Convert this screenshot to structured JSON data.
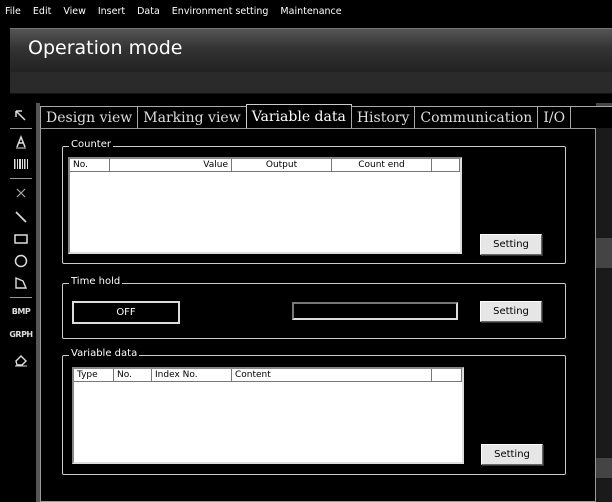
{
  "menu": [
    "File",
    "Edit",
    "View",
    "Insert",
    "Data",
    "Environment setting",
    "Maintenance"
  ],
  "title": "Operation mode",
  "toolbar": {
    "tools": [
      {
        "icon": "pointer-icon",
        "glyph": "↖"
      },
      {
        "icon": "text-icon",
        "glyph": "A"
      },
      {
        "icon": "barcode-icon",
        "glyph": "▥"
      },
      {
        "icon": "point-icon",
        "glyph": "×"
      },
      {
        "icon": "line-icon",
        "glyph": "╲"
      },
      {
        "icon": "rectangle-icon",
        "glyph": "▭"
      },
      {
        "icon": "circle-icon",
        "glyph": "○"
      },
      {
        "icon": "polyline-icon",
        "glyph": "⌐"
      },
      {
        "icon": "bmp-icon",
        "text": "BMP"
      },
      {
        "icon": "graph-icon",
        "text": "GRPH"
      },
      {
        "icon": "eraser-icon",
        "glyph": "⌫"
      }
    ]
  },
  "tabs": [
    "Design view",
    "Marking view",
    "Variable data",
    "History",
    "Communication",
    "I/O"
  ],
  "active_tab": "Variable data",
  "counter": {
    "legend": "Counter",
    "columns": [
      "No.",
      "Value",
      "Output",
      "Count end"
    ],
    "button": "Setting"
  },
  "time_hold": {
    "legend": "Time hold",
    "status": "OFF",
    "button": "Setting"
  },
  "variable_data": {
    "legend": "Variable data",
    "columns": [
      "Type",
      "No.",
      "Index No.",
      "Content"
    ],
    "button": "Setting"
  }
}
